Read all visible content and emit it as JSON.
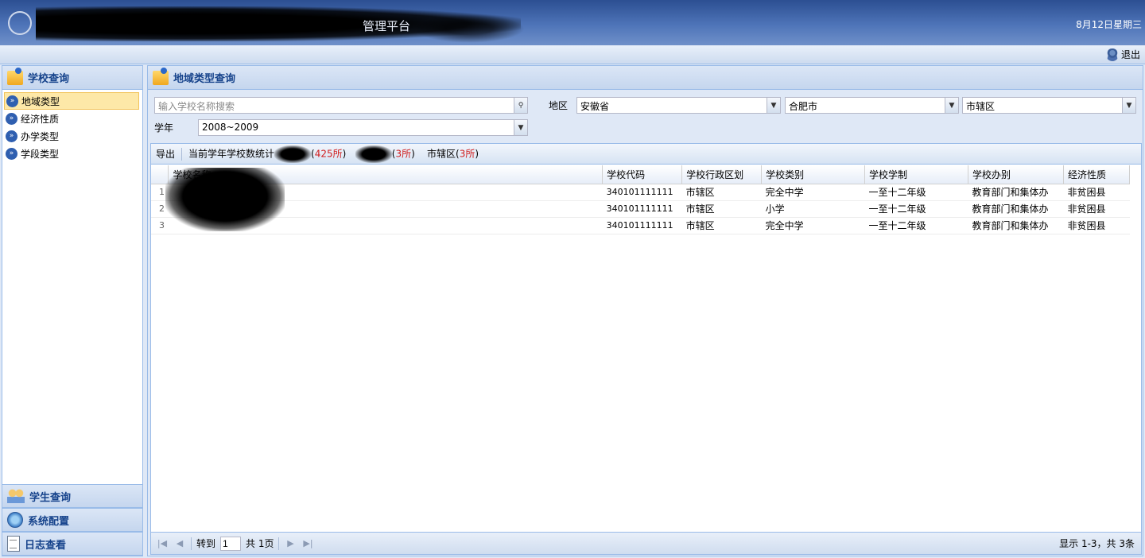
{
  "header": {
    "app_title": "管理平台",
    "date": "8月12日星期三"
  },
  "subbar": {
    "logout_label": "退出"
  },
  "sidebar": {
    "section_title": "学校查询",
    "items": [
      {
        "label": "地域类型"
      },
      {
        "label": "经济性质"
      },
      {
        "label": "办学类型"
      },
      {
        "label": "学段类型"
      }
    ],
    "bottom_sections": [
      "学生查询",
      "系统配置",
      "日志查看"
    ]
  },
  "main": {
    "title": "地域类型查询",
    "search": {
      "placeholder": "输入学校名称搜索"
    },
    "region_label": "地区",
    "province": "安徽省",
    "city": "合肥市",
    "district": "市辖区",
    "year_label": "学年",
    "year": "2008~2009"
  },
  "toolbar": {
    "export_label": "导出",
    "stats_prefix": "当前学年学校数统计",
    "count1": "425所",
    "count2": "3所",
    "district_label": "市辖区",
    "count3": "3所"
  },
  "table": {
    "columns": [
      "学校名称",
      "学校代码",
      "学校行政区划",
      "学校类别",
      "学校学制",
      "学校办别",
      "经济性质"
    ],
    "rows": [
      {
        "num": "1",
        "code": "340101111111",
        "district": "市辖区",
        "category": "完全中学",
        "system": "一至十二年级",
        "office": "教育部门和集体办",
        "economy": "非贫困县"
      },
      {
        "num": "2",
        "code": "340101111111",
        "district": "市辖区",
        "category": "小学",
        "system": "一至十二年级",
        "office": "教育部门和集体办",
        "economy": "非贫困县"
      },
      {
        "num": "3",
        "code": "340101111111",
        "district": "市辖区",
        "category": "完全中学",
        "system": "一至十二年级",
        "office": "教育部门和集体办",
        "economy": "非贫困县"
      }
    ]
  },
  "pager": {
    "goto_label": "转到",
    "page_value": "1",
    "total_pages": "共 1页",
    "info": "显示 1-3，共 3条"
  }
}
